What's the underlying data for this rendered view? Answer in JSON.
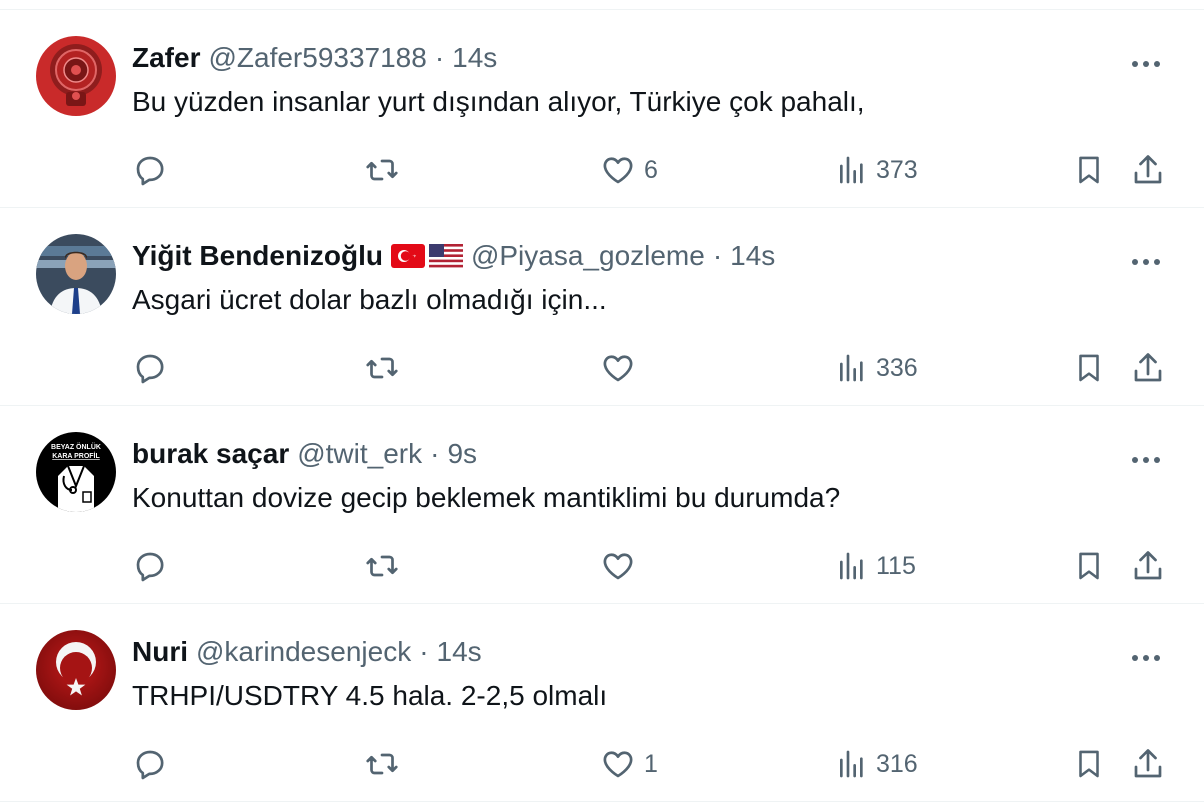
{
  "tweets": [
    {
      "name": "Zafer",
      "handle": "@Zafer59337188",
      "dot": "·",
      "time": "14s",
      "text": "Bu yüzden insanlar yurt dışından alıyor, Türkiye çok pahalı,",
      "reply_count": "",
      "retweet_count": "",
      "like_count": "6",
      "view_count": "373",
      "avatar_icon": "red-mandala-avatar"
    },
    {
      "name": "Yiğit Bendenizoğlu",
      "handle": "@Piyasa_gozleme",
      "dot": "·",
      "time": "14s",
      "text": "Asgari ücret dolar bazlı olmadığı için...",
      "reply_count": "",
      "retweet_count": "",
      "like_count": "",
      "view_count": "336",
      "flags": [
        "turkey-flag-icon",
        "usa-flag-icon"
      ],
      "avatar_icon": "man-in-suit-avatar"
    },
    {
      "name": "burak saçar",
      "handle": "@twit_erk",
      "dot": "·",
      "time": "9s",
      "text": "Konuttan dovize gecip beklemek mantiklimi bu durumda?",
      "reply_count": "",
      "retweet_count": "",
      "like_count": "",
      "view_count": "115",
      "avatar_icon": "black-coat-avatar",
      "avatar_text_1": "BEYAZ ÖNLÜK",
      "avatar_text_2": "KARA PROFİL"
    },
    {
      "name": "Nuri",
      "handle": "@karindesenjeck",
      "dot": "·",
      "time": "14s",
      "text": "TRHPI/USDTRY 4.5 hala. 2-2,5 olmalı",
      "reply_count": "",
      "retweet_count": "",
      "like_count": "1",
      "view_count": "316",
      "avatar_icon": "crescent-star-avatar"
    }
  ],
  "colors": {
    "text_primary": "#0f1419",
    "text_secondary": "#536471",
    "border": "#eff3f4"
  }
}
